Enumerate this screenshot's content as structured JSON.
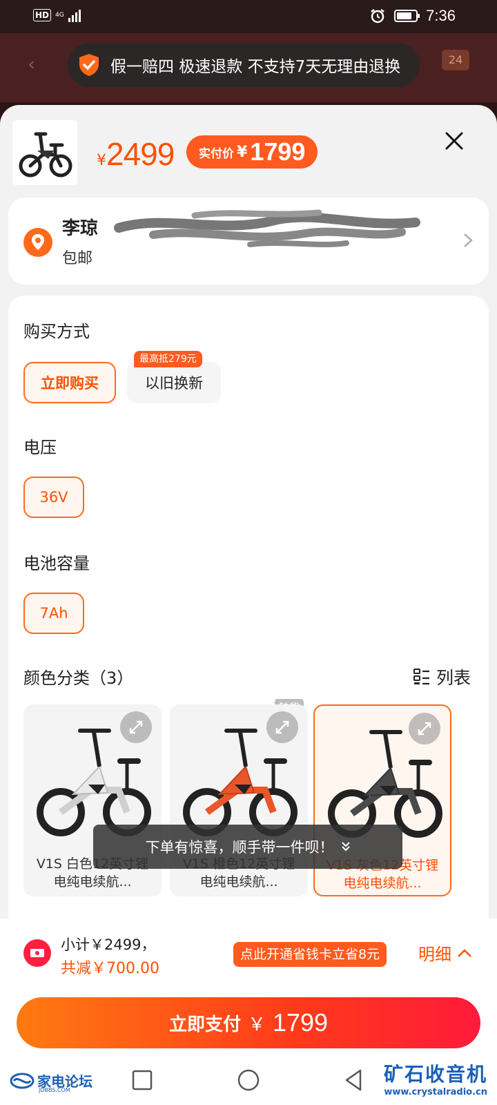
{
  "status_bar": {
    "network_hd": "HD",
    "network_type": "4G",
    "time": "7:36"
  },
  "background": {
    "badge": "24"
  },
  "guarantee_toast": {
    "text": "假一赔四 极速退款 不支持7天无理由退换"
  },
  "product": {
    "currency": "¥",
    "list_price": "2499",
    "pay_label": "实付价",
    "pay_currency": "¥",
    "pay_price": "1799"
  },
  "address": {
    "name": "李琼",
    "shipping": "包邮"
  },
  "purchase_method": {
    "title": "购买方式",
    "options": [
      {
        "label": "立即购买",
        "selected": true
      },
      {
        "label": "以旧换新",
        "selected": false
      }
    ],
    "trade_in_tag": "最高抵279元"
  },
  "voltage": {
    "title": "电压",
    "value": "36V"
  },
  "battery": {
    "title": "电池容量",
    "value": "7Ah"
  },
  "color": {
    "title": "颜色分类（3）",
    "list_label": "列表",
    "out_of_stock": "缺货",
    "items": [
      {
        "line1": "V1S 白色12英寸锂",
        "line2": "电纯电续航...",
        "frame": "#e9e9e9",
        "selected": false
      },
      {
        "line1": "V1S 橙色12英寸锂",
        "line2": "电纯电续航...",
        "frame": "#e8562a",
        "selected": false
      },
      {
        "line1": "V1S 灰色12英寸锂",
        "line2": "电纯电续航...",
        "frame": "#4a4a4a",
        "selected": true
      }
    ]
  },
  "hint_toast": {
    "text": "下单有惊喜，顺手带一件呗！"
  },
  "summary": {
    "subtotal": "小计￥2499，",
    "discount": "共减￥700.00",
    "save_card": "点此开通省钱卡立省8元",
    "detail": "明细"
  },
  "pay_button": {
    "label": "立即支付",
    "currency": "￥",
    "amount": "1799"
  },
  "watermarks": {
    "left_title": "家电论坛",
    "left_sub": "JDBBS.COM",
    "right_title": "矿石收音机",
    "right_sub": "www.crystalradio.cn"
  },
  "colors": {
    "accent": "#ff5000",
    "pill": "#ff5a1f"
  }
}
